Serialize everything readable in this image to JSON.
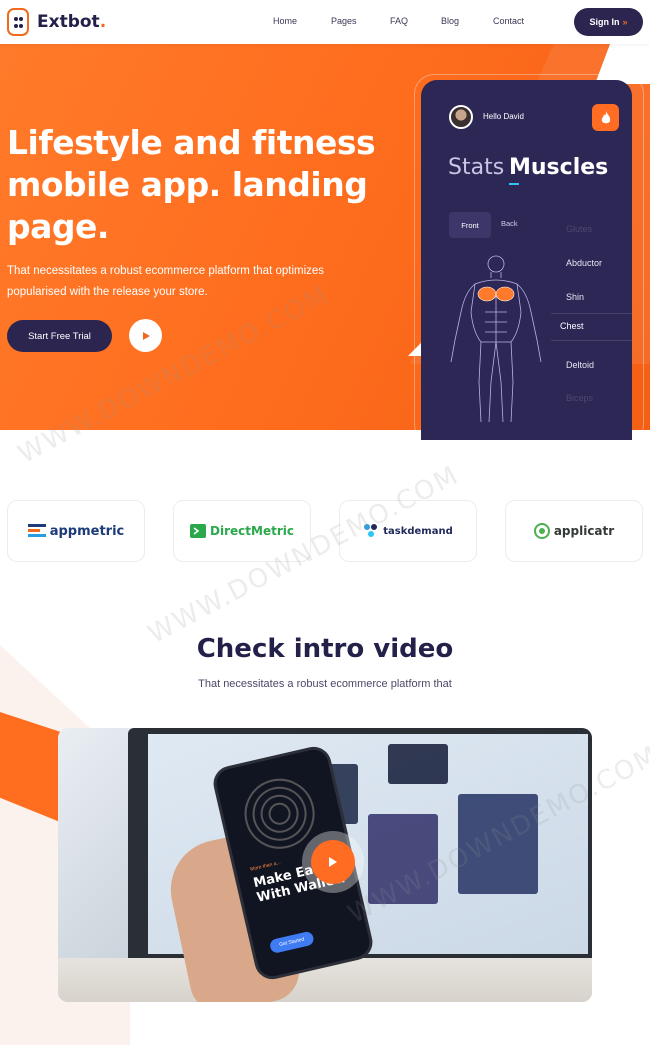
{
  "brand": {
    "name": "Extbot",
    "dot": ".",
    "accent": "#f26a1e",
    "dark": "#2b2550"
  },
  "nav": {
    "items": [
      "Home",
      "Pages",
      "FAQ",
      "Blog",
      "Contact"
    ],
    "signin_label": "Sign In",
    "signin_icon": "double-chevron-right-icon"
  },
  "hero": {
    "title": "Lifestyle and fitness mobile app. landing page.",
    "subtitle": "That necessitates a robust ecommerce platform that optimizes popularised with the release your store.",
    "cta_label": "Start Free Trial",
    "play_icon": "play-icon"
  },
  "app": {
    "greeting": "Hello David",
    "tab_inactive": "Stats",
    "tab_active": "Muscles",
    "view_front": "Front",
    "view_back": "Back",
    "muscles": [
      "Glutes",
      "Abductor",
      "Shin",
      "Chest",
      "Deltoid",
      "Biceps"
    ],
    "selected_muscle": "Chest"
  },
  "partners": [
    {
      "name": "appmetric",
      "icon": "appmetric-logo-icon",
      "color": "#1d3a7a"
    },
    {
      "name": "DirectMetric",
      "icon": "directmetric-logo-icon",
      "color": "#2aa84a"
    },
    {
      "name": "taskdemand",
      "icon": "taskdemand-logo-icon",
      "color": "#1e2a5a"
    },
    {
      "name": "applicatr",
      "icon": "applicatr-logo-icon",
      "color": "#333a36"
    }
  ],
  "intro": {
    "title": "Check intro video",
    "subtitle": "That necessitates a robust ecommerce platform that",
    "phone_tag": "More than a...",
    "phone_headline": "Make Easier With Wallet.",
    "phone_button": "Get Started"
  },
  "watermark": "WWW.DOWNDEMO.COM"
}
